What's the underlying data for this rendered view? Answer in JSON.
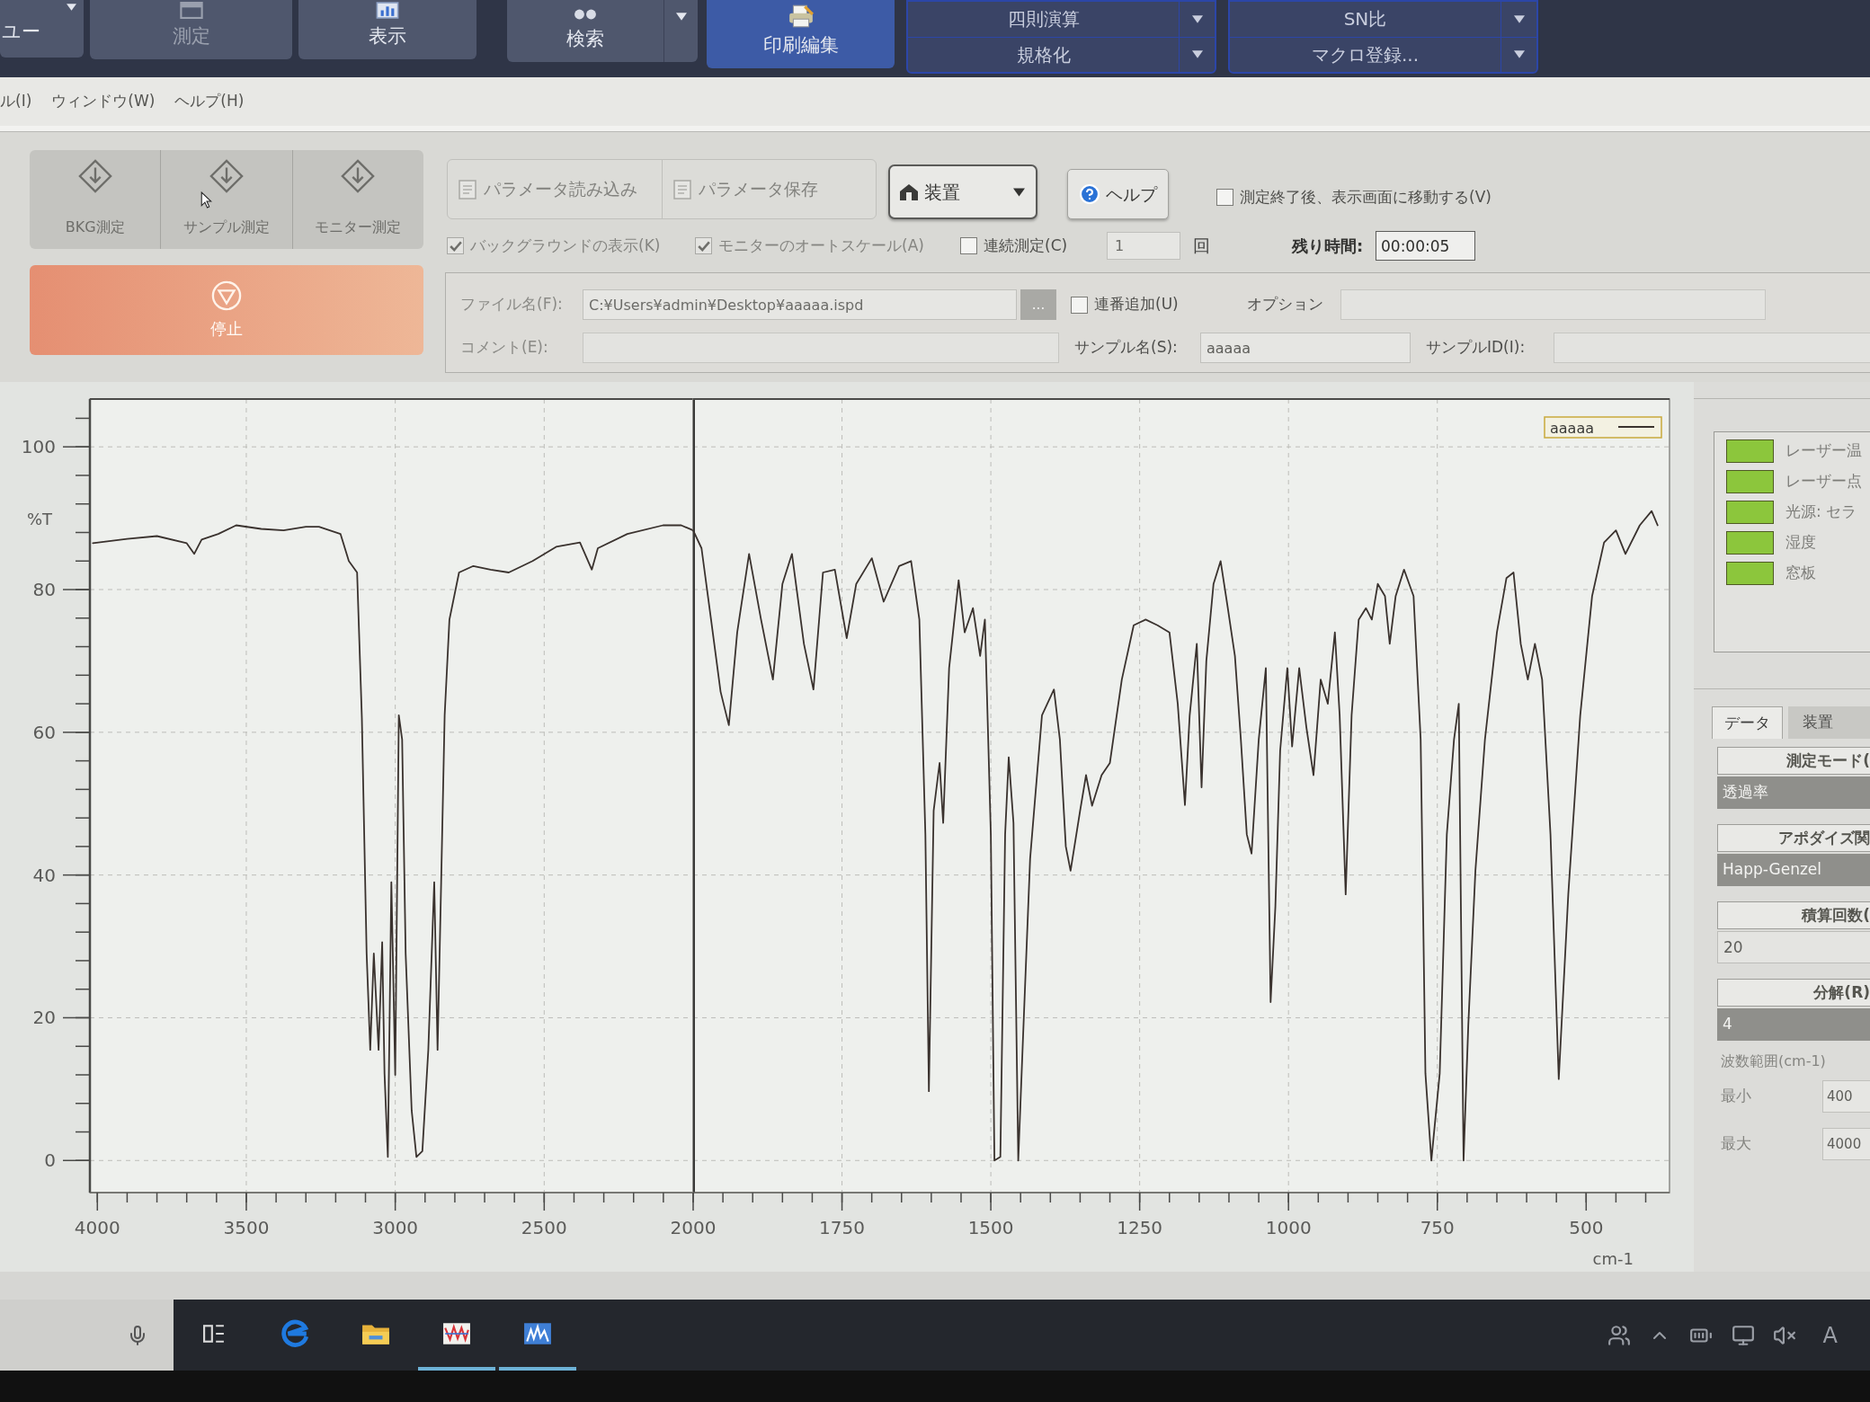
{
  "ribbon": {
    "items": [
      {
        "kind": "menu",
        "label": "ユー",
        "selected": false,
        "disabled": false
      },
      {
        "kind": "tool",
        "label": "測定",
        "selected": false,
        "disabled": true
      },
      {
        "kind": "tool",
        "label": "表示",
        "selected": false,
        "disabled": false
      },
      {
        "kind": "split",
        "label": "検索",
        "selected": false,
        "disabled": false
      },
      {
        "kind": "tool",
        "label": "印刷編集",
        "selected": true,
        "disabled": false
      }
    ],
    "groups": [
      {
        "items": [
          {
            "label": "四則演算"
          },
          {
            "label": "規格化"
          }
        ]
      },
      {
        "items": [
          {
            "label": "SN比"
          },
          {
            "label": "マクロ登録..."
          }
        ]
      }
    ]
  },
  "menu_bar": {
    "items": [
      "ル(I)",
      "ウィンドウ(W)",
      "ヘルプ(H)"
    ]
  },
  "measure_buttons": [
    {
      "label": "BKG測定",
      "disabled": true
    },
    {
      "label": "サンプル測定",
      "disabled": true
    },
    {
      "label": "モニター測定",
      "disabled": true
    }
  ],
  "stop_button": {
    "label": "停止"
  },
  "parameter_buttons": [
    {
      "label": "パラメータ読み込み",
      "disabled": true
    },
    {
      "label": "パラメータ保存",
      "disabled": true
    }
  ],
  "device_button": {
    "label": "装置"
  },
  "help_button": {
    "label": "ヘルプ"
  },
  "move_after_measure": {
    "label": "測定終了後、表示画面に移動する(V)",
    "checked": false,
    "disabled": false
  },
  "options": [
    {
      "label": "バックグラウンドの表示(K)",
      "checked": true,
      "disabled": true
    },
    {
      "label": "モニターのオートスケール(A)",
      "checked": true,
      "disabled": true
    },
    {
      "label": "連続測定(C)",
      "checked": false,
      "disabled": false
    }
  ],
  "repeat_count": {
    "value": "1",
    "unit": "回"
  },
  "remaining_time": {
    "label": "残り時間:",
    "value": "00:00:05"
  },
  "file_form": {
    "file_name": {
      "label": "ファイル名(F):",
      "value": "C:¥Users¥admin¥Desktop¥aaaaa.ispd",
      "disabled": true
    },
    "browse_button": {
      "label": "..."
    },
    "serial_number": {
      "label": "連番追加(U)",
      "checked": false,
      "disabled": false
    },
    "option": {
      "label": "オプション"
    },
    "comment": {
      "label": "コメント(E):",
      "disabled": true
    },
    "sample_name": {
      "label": "サンプル名(S):",
      "value": "aaaaa"
    },
    "sample_id": {
      "label": "サンプルID(I):"
    }
  },
  "chart": {
    "segments": [
      {
        "chart_data": {
          "type": "line",
          "ylabel": "%T",
          "x": [
            4015,
            3900,
            3800,
            3700,
            3675,
            3650,
            3594,
            3534,
            3450,
            3375,
            3300,
            3256,
            3184,
            3156,
            3128,
            3112,
            3096,
            3084,
            3072,
            3056,
            3044,
            3036,
            3025,
            3013,
            3000,
            2988,
            2977,
            2965,
            2945,
            2929,
            2909,
            2889,
            2869,
            2858,
            2846,
            2834,
            2818,
            2786,
            2738,
            2680,
            2619,
            2539,
            2460,
            2380,
            2340,
            2320,
            2221,
            2101,
            2040,
            2000
          ],
          "series": [
            {
              "color": "#3a322e",
              "values": [
                86.5,
                87.1,
                87.5,
                86.5,
                85.0,
                87.0,
                87.8,
                89.0,
                88.5,
                88.3,
                88.8,
                88.8,
                87.8,
                84.0,
                82.4,
                62.0,
                29.0,
                15.5,
                29.0,
                15.5,
                30.6,
                12.2,
                0.5,
                39.0,
                12.0,
                62.4,
                59.0,
                29.0,
                7.0,
                0.5,
                1.3,
                15.5,
                39.0,
                15.5,
                39.0,
                62.4,
                75.8,
                82.4,
                83.3,
                82.8,
                82.4,
                84.0,
                86.0,
                86.6,
                82.8,
                85.8,
                87.8,
                89.0,
                89.0,
                88.3
              ]
            }
          ],
          "xlim": [
            4025,
            2000
          ],
          "ylim": [
            -4.5,
            106.7
          ],
          "xticks": [
            4000,
            3500,
            3000,
            2500
          ],
          "yticks": [
            0,
            20,
            40,
            60,
            80,
            100
          ],
          "grid": true
        }
      },
      {
        "chart_data": {
          "type": "line",
          "xlabel": "cm-1",
          "x": [
            2000,
            1986,
            1970,
            1954,
            1940,
            1926,
            1906,
            1886,
            1866,
            1850,
            1834,
            1814,
            1798,
            1782,
            1762,
            1742,
            1726,
            1700,
            1680,
            1654,
            1634,
            1620,
            1610,
            1604,
            1596,
            1586,
            1580,
            1570,
            1554,
            1544,
            1530,
            1518,
            1510,
            1500,
            1494,
            1484,
            1476,
            1470,
            1462,
            1454,
            1446,
            1434,
            1414,
            1394,
            1384,
            1374,
            1366,
            1350,
            1340,
            1330,
            1314,
            1300,
            1280,
            1260,
            1240,
            1220,
            1200,
            1186,
            1174,
            1166,
            1154,
            1146,
            1138,
            1126,
            1114,
            1102,
            1090,
            1080,
            1070,
            1062,
            1050,
            1038,
            1030,
            1022,
            1014,
            1002,
            994,
            982,
            970,
            958,
            946,
            934,
            922,
            914,
            904,
            894,
            882,
            870,
            860,
            850,
            838,
            830,
            820,
            806,
            790,
            778,
            770,
            760,
            746,
            734,
            722,
            714,
            706,
            698,
            686,
            670,
            650,
            634,
            622,
            610,
            598,
            586,
            574,
            560,
            546,
            530,
            510,
            490,
            470,
            450,
            434,
            410,
            390,
            380
          ],
          "series": [
            {
              "name": "aaaaa",
              "color": "#3a322e",
              "values": [
                88.3,
                85.8,
                75.8,
                65.7,
                61.0,
                74.0,
                85.0,
                75.8,
                67.4,
                80.8,
                85.0,
                72.4,
                66.0,
                82.4,
                82.8,
                73.2,
                80.8,
                84.4,
                78.3,
                83.3,
                84.0,
                75.8,
                45.7,
                9.7,
                49.0,
                55.7,
                47.3,
                69.0,
                81.3,
                74.0,
                77.4,
                70.7,
                75.8,
                45.7,
                0.0,
                0.5,
                45.7,
                56.5,
                47.3,
                0.0,
                17.2,
                42.3,
                62.4,
                66.0,
                59.0,
                44.0,
                40.6,
                49.0,
                54.0,
                49.7,
                54.0,
                55.7,
                67.4,
                75.0,
                75.8,
                75.0,
                74.0,
                64.0,
                49.8,
                62.4,
                72.4,
                52.3,
                70.0,
                80.8,
                84.0,
                77.4,
                70.7,
                59.0,
                45.7,
                43.0,
                59.0,
                69.0,
                22.2,
                35.6,
                57.4,
                69.0,
                58.0,
                69.0,
                60.7,
                54.0,
                67.4,
                64.0,
                74.0,
                62.4,
                37.3,
                62.4,
                75.8,
                77.4,
                75.8,
                80.8,
                79.1,
                72.4,
                79.1,
                82.8,
                79.1,
                59.0,
                12.2,
                0.0,
                12.2,
                45.7,
                59.0,
                64.0,
                0.0,
                19.0,
                40.6,
                59.0,
                74.0,
                81.6,
                82.4,
                72.4,
                67.4,
                72.4,
                67.4,
                45.7,
                11.4,
                37.3,
                62.4,
                79.1,
                86.6,
                88.3,
                85.0,
                89.0,
                91.0,
                89.0
              ]
            }
          ],
          "xlim": [
            2000,
            360
          ],
          "ylim": [
            -4.5,
            106.7
          ],
          "xticks": [
            2000,
            1750,
            1500,
            1250,
            1000,
            750,
            500
          ],
          "grid": true
        }
      }
    ]
  },
  "status_indicators": [
    {
      "label": "レーザー温",
      "color": "#8cc63c"
    },
    {
      "label": "レーザー点",
      "color": "#8cc63c"
    },
    {
      "label": "光源: セラ",
      "color": "#8cc63c"
    },
    {
      "label": "湿度",
      "color": "#8cc63c"
    },
    {
      "label": "窓板",
      "color": "#8cc63c"
    }
  ],
  "info_tabs": [
    {
      "label": "データ",
      "selected": true
    },
    {
      "label": "装置",
      "selected": false
    }
  ],
  "info_fields": [
    {
      "label": "測定モード(",
      "value": "透過率",
      "disabled": true
    },
    {
      "label": "アポダイズ関",
      "value": "Happ-Genzel",
      "disabled": true
    },
    {
      "label": "積算回数(",
      "value": "20",
      "disabled": false
    },
    {
      "label": "分解(R)",
      "value": "4",
      "disabled": true
    }
  ],
  "wavenumber_range": {
    "label": "波数範囲(cm-1)",
    "min": {
      "label": "最小",
      "value": "400"
    },
    "max": {
      "label": "最大",
      "value": "4000"
    }
  },
  "taskbar": {
    "buttons": [
      {
        "running": false
      },
      {
        "running": false
      },
      {
        "running": false
      },
      {
        "running": true
      },
      {
        "running": true
      }
    ],
    "ime": "A"
  }
}
